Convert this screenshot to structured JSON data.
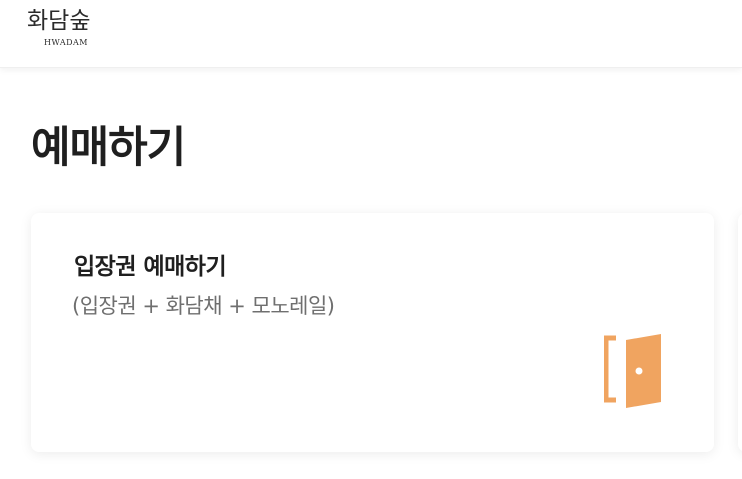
{
  "header": {
    "logo_text": "화담숲",
    "logo_subtext": "HWADAM"
  },
  "main": {
    "page_title": "예매하기"
  },
  "cards": [
    {
      "title": "입장권 예매하기",
      "subtitle": "(입장권 + 화담채 + 모노레일)",
      "icon": "door-icon",
      "icon_color": "#f0a460"
    }
  ]
}
